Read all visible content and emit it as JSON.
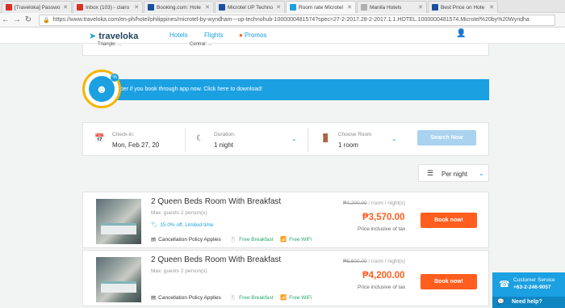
{
  "browser": {
    "tabs": [
      {
        "title": "[Traveloka] Passwo",
        "favicon_color": "#d93025"
      },
      {
        "title": "Inbox (103) - clairo",
        "favicon_color": "#d93025"
      },
      {
        "title": "Booking.com: Hote",
        "favicon_color": "#1a4fa0"
      },
      {
        "title": "Microtel UP Techno",
        "favicon_color": "#1a4fa0"
      },
      {
        "title": "Room rate Microtel",
        "favicon_color": "#1ba0e2"
      },
      {
        "title": "Manila Hotels",
        "favicon_color": "#b0b0b0"
      },
      {
        "title": "Best Price on Hote",
        "favicon_color": "#1a4fa0"
      }
    ],
    "url": "https://www.traveloka.com/en-ph/hotel/philippines/microtel-by-wyndham---up-technohub-1000000481574?spec=27-2-2017.28-2-2017.1.1.HOTEL.1000000481574.Microtel%20by%20Wyndha"
  },
  "header": {
    "logo_text": "traveloka",
    "nav": {
      "hotels": "Hotels",
      "flights": "Flights",
      "promos": "Promos"
    }
  },
  "topcard": {
    "left_text": "Triangle: ...",
    "right_text": "Central: ..."
  },
  "banner": {
    "text": "Cheaper if you book through app now. Click here to download!",
    "badge_pct": "%"
  },
  "search": {
    "checkin_label": "Check-in:",
    "checkin_value": "Mon, Feb 27, 20",
    "duration_label": "Duration:",
    "duration_value": "1 night",
    "room_label": "Choose Room",
    "room_value": "1 room",
    "button": "Search Now"
  },
  "price_mode": "Per night",
  "rooms": [
    {
      "name": "2 Queen Beds Room With Breakfast",
      "guests": "Max. guests 2 person(s)",
      "promo": "15.0% off, Limited time",
      "old_price": "₱4,200.00",
      "old_price_suffix": " / room / night(s)",
      "price": "₱3,570.00",
      "tax_note": "Price inclusive of tax",
      "book": "Book now!",
      "amenities": {
        "cancel": "Cancellation Policy Applies",
        "breakfast": "Free Breakfast",
        "wifi": "Free WiFi"
      }
    },
    {
      "name": "2 Queen Beds Room With Breakfast",
      "guests": "Max. guests 2 person(s)",
      "promo": "",
      "old_price": "₱5,600.00",
      "old_price_suffix": " / room / night(s)",
      "price": "₱4,200.00",
      "tax_note": "Price inclusive of tax",
      "book": "Book now!",
      "amenities": {
        "cancel": "Cancellation Policy Applies",
        "breakfast": "Free Breakfast",
        "wifi": "Free WiFi"
      }
    }
  ],
  "customer_service": {
    "label": "Customer Service",
    "phone": "+63-2-246-9057",
    "help": "Need help?"
  },
  "colors": {
    "brand_blue": "#1ba0e2",
    "orange": "#ff5e1f",
    "green": "#27a96c"
  }
}
